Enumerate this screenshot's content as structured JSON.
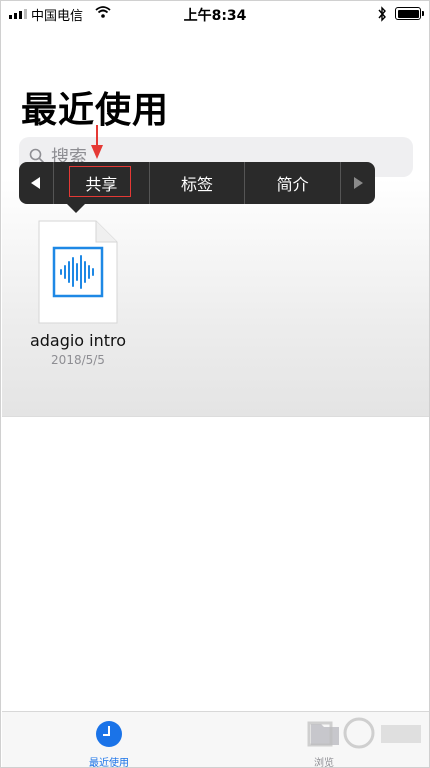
{
  "status_bar": {
    "carrier": "中国电信",
    "time": "上午8:34"
  },
  "page": {
    "title": "最近使用"
  },
  "search": {
    "placeholder": "搜索"
  },
  "context_menu": {
    "items": [
      "共享",
      "标签",
      "简介"
    ],
    "highlighted": "共享"
  },
  "file": {
    "name": "adagio intro",
    "date": "2018/5/5",
    "accent_color": "#1e88e5"
  },
  "tab_bar": {
    "tabs": [
      {
        "label": "最近使用",
        "active": true
      },
      {
        "label": "浏览",
        "active": false
      }
    ]
  },
  "colors": {
    "accent": "#1a73e8",
    "annotation": "#e53935"
  }
}
